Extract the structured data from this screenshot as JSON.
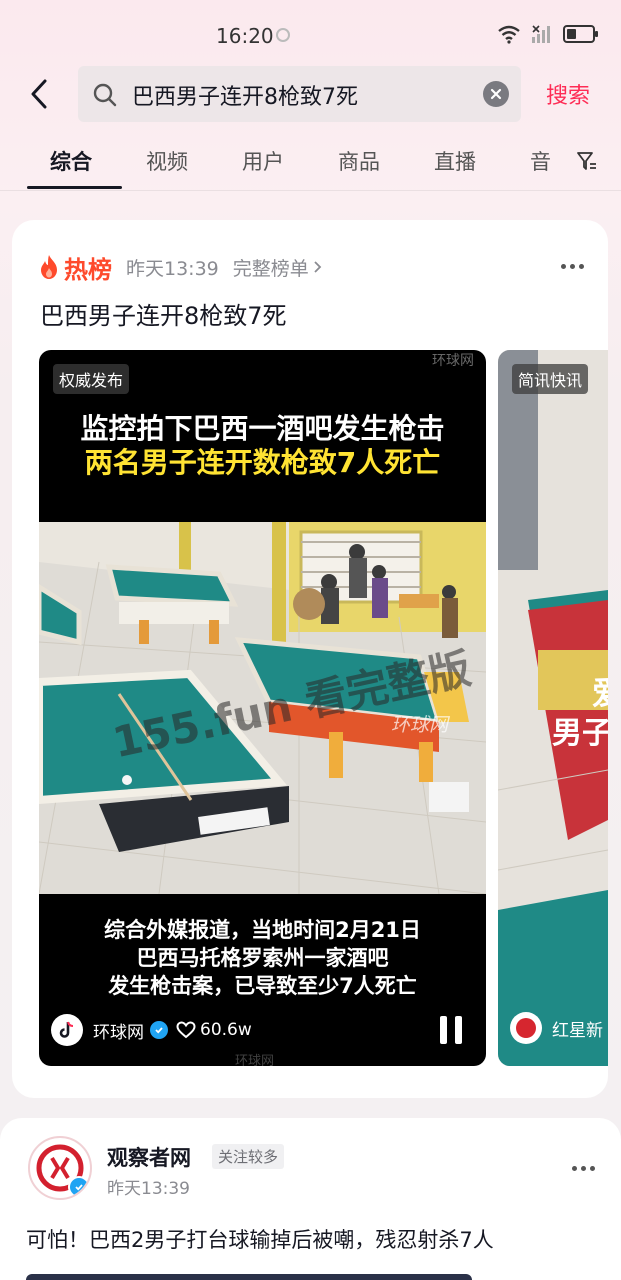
{
  "status_bar": {
    "time": "16:20"
  },
  "search": {
    "query": "巴西男子连开8枪致7死",
    "submit_label": "搜索"
  },
  "tabs": [
    "综合",
    "视频",
    "用户",
    "商品",
    "直播",
    "音"
  ],
  "hot_card": {
    "badge": "热榜",
    "time": "昨天13:39",
    "full_list": "完整榜单",
    "headline": "巴西男子连开8枪致7死",
    "video": {
      "tag": "权威发布",
      "watermark_top": "环球网",
      "heading_line1": "监控拍下巴西一酒吧发生枪击",
      "heading_line2": "两名男子连开数枪致7人死亡",
      "overlay_watermark": "155.fun 看完整版",
      "overlay_watermark2": "环球网",
      "caption_line1": "综合外媒报道，当地时间2月21日",
      "caption_line2": "巴西马托格罗索州一家酒吧",
      "caption_line3": "发生枪击案，已导致至少7人死亡",
      "author": "环球网",
      "likes": "60.6w",
      "watermark_bottom": "环球网"
    },
    "side_video": {
      "tag": "简讯快讯",
      "overlay_text": "男子",
      "overlay_text_top": "爱",
      "author": "红星新"
    }
  },
  "post": {
    "author": "观察者网",
    "follow_tag": "关注较多",
    "time": "昨天13:39",
    "title": "可怕！巴西2男子打台球输掉后被嘲，残忍射杀7人"
  },
  "colors": {
    "accent": "#fe2c55",
    "hot": "#fe4a2c",
    "heading_yellow": "#ffe333"
  }
}
